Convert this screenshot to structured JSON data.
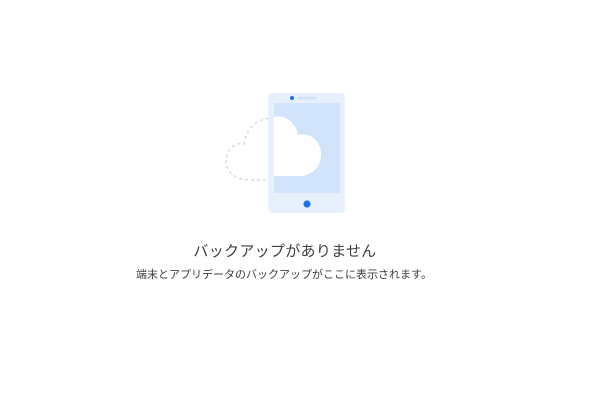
{
  "empty_state": {
    "title": "バックアップがありません",
    "subtitle": "端末とアプリデータのバックアップがここに表示されます。",
    "illustration": "phone-cloud-backup-icon"
  },
  "colors": {
    "background": "#ffffff",
    "text": "#3c4043",
    "phone_body": "#e8f0fe",
    "screen": "#d2e3fc",
    "accent": "#1a73e8",
    "dashed_outline": "#dadce0"
  }
}
